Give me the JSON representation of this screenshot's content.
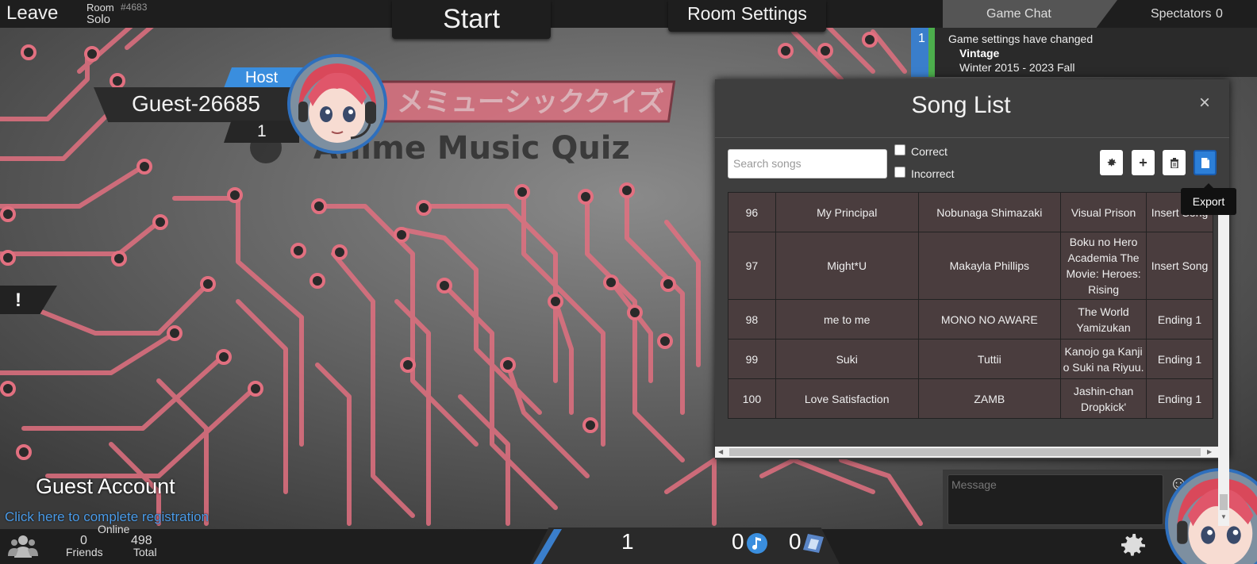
{
  "topbar": {
    "leave_label": "Leave",
    "room_word": "Room",
    "room_id": "#4683",
    "room_mode": "Solo",
    "start_label": "Start",
    "room_settings_label": "Room Settings"
  },
  "chat": {
    "tab_game_chat": "Game Chat",
    "spectators_label": "Spectators",
    "spectators_count": "0",
    "message": {
      "number": "1",
      "line1": "Game settings have changed",
      "line2": "Vintage",
      "line3": "Winter 2015 - 2023 Fall"
    },
    "input_placeholder": "Message"
  },
  "player": {
    "host_label": "Host",
    "name": "Guest-26685",
    "score": "1"
  },
  "warning_symbol": "!",
  "song_list": {
    "title": "Song List",
    "close_symbol": "×",
    "search_placeholder": "Search songs",
    "filter_correct": "Correct",
    "filter_incorrect": "Incorrect",
    "export_tooltip": "Export",
    "rows": [
      {
        "num": "96",
        "song": "My Principal",
        "artist": "Nobunaga Shimazaki",
        "anime": "Visual Prison",
        "type": "Insert Song"
      },
      {
        "num": "97",
        "song": "Might*U",
        "artist": "Makayla Phillips",
        "anime": "Boku no Hero Academia The Movie: Heroes: Rising",
        "type": "Insert Song"
      },
      {
        "num": "98",
        "song": "me to me",
        "artist": "MONO NO AWARE",
        "anime": "The World Yamizukan",
        "type": "Ending 1"
      },
      {
        "num": "99",
        "song": "Suki",
        "artist": "Tuttii",
        "anime": "Kanojo ga Kanji o Suki na Riyuu.",
        "type": "Ending 1"
      },
      {
        "num": "100",
        "song": "Love Satisfaction",
        "artist": "ZAMB",
        "anime": "Jashin-chan Dropkick'",
        "type": "Ending 1"
      }
    ]
  },
  "guest": {
    "title": "Guest Account",
    "link": "Click here to complete registration"
  },
  "bottombar": {
    "online_label": "Online",
    "friends_count": "0",
    "friends_label": "Friends",
    "total_count": "498",
    "total_label": "Total",
    "level": "1",
    "notes": "0",
    "tickets": "0"
  },
  "colors": {
    "accent_blue": "#2e6fbd",
    "chat_green": "#4cae4c",
    "table_cell": "#4a3d3e",
    "circuit_red": "#e06070"
  }
}
